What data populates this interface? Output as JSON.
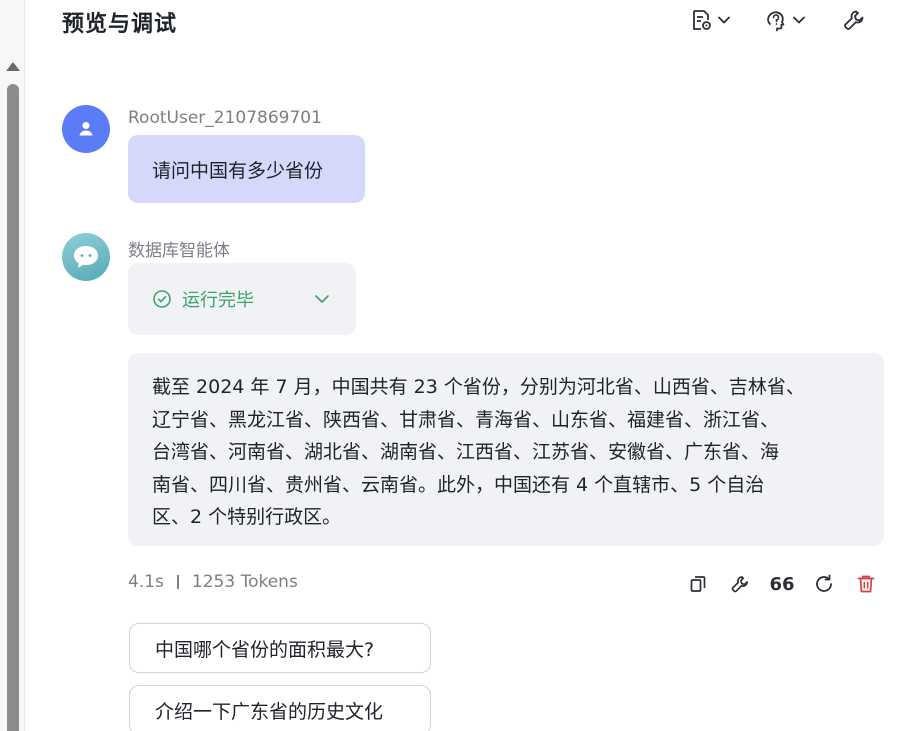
{
  "header": {
    "title": "预览与调试"
  },
  "user_message": {
    "sender": "RootUser_2107869701",
    "text": "请问中国有多少省份"
  },
  "bot_message": {
    "sender": "数据库智能体",
    "status": "运行完毕",
    "answer_lines": [
      "截至 2024 年 7 月，中国共有 23 个省份，分别为河北省、山西省、吉林省、",
      "辽宁省、黑龙江省、陕西省、甘肃省、青海省、山东省、福建省、浙江省、",
      "台湾省、河南省、湖北省、湖南省、江西省、江苏省、安徽省、广东省、海",
      "南省、四川省、贵州省、云南省。此外，中国还有 4 个直辖市、5 个自治",
      "区、2 个特别行政区。"
    ],
    "duration": "4.1s",
    "tokens": "1253 Tokens",
    "quote_label": "66"
  },
  "suggestions": [
    "中国哪个省份的面积最大?",
    "介绍一下广东省的历史文化"
  ],
  "colors": {
    "user_bubble": "#d5d8fb",
    "user_avatar": "#5b7cf6",
    "status_green": "#3aa46a",
    "delete_red": "#e0393e"
  }
}
